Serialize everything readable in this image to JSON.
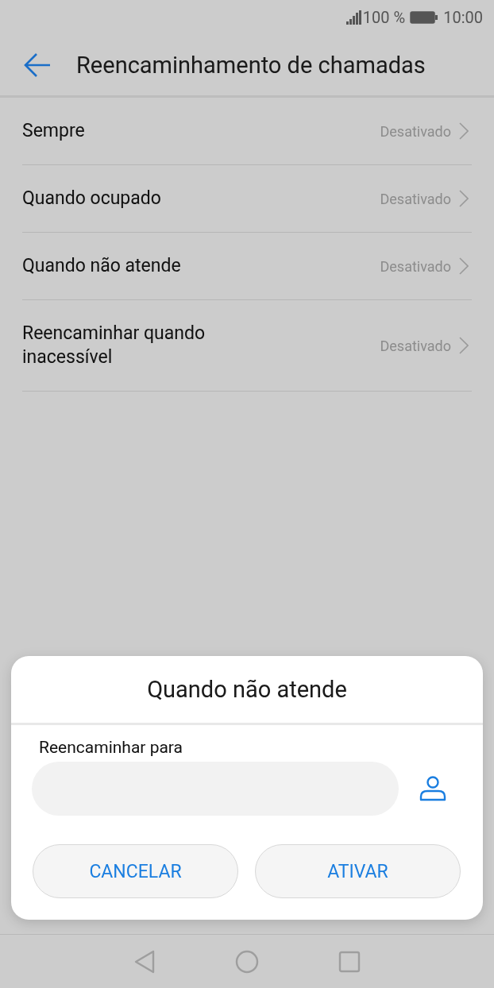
{
  "status_bar": {
    "battery": "100 %",
    "time": "10:00"
  },
  "header": {
    "title": "Reencaminhamento de chamadas"
  },
  "settings": [
    {
      "label": "Sempre",
      "value": "Desativado"
    },
    {
      "label": "Quando ocupado",
      "value": "Desativado"
    },
    {
      "label": "Quando não atende",
      "value": "Desativado"
    },
    {
      "label": "Reencaminhar quando inacessível",
      "value": "Desativado"
    }
  ],
  "dialog": {
    "title": "Quando não atende",
    "field_label": "Reencaminhar para",
    "buttons": [
      "CANCELAR",
      "ATIVAR"
    ]
  }
}
